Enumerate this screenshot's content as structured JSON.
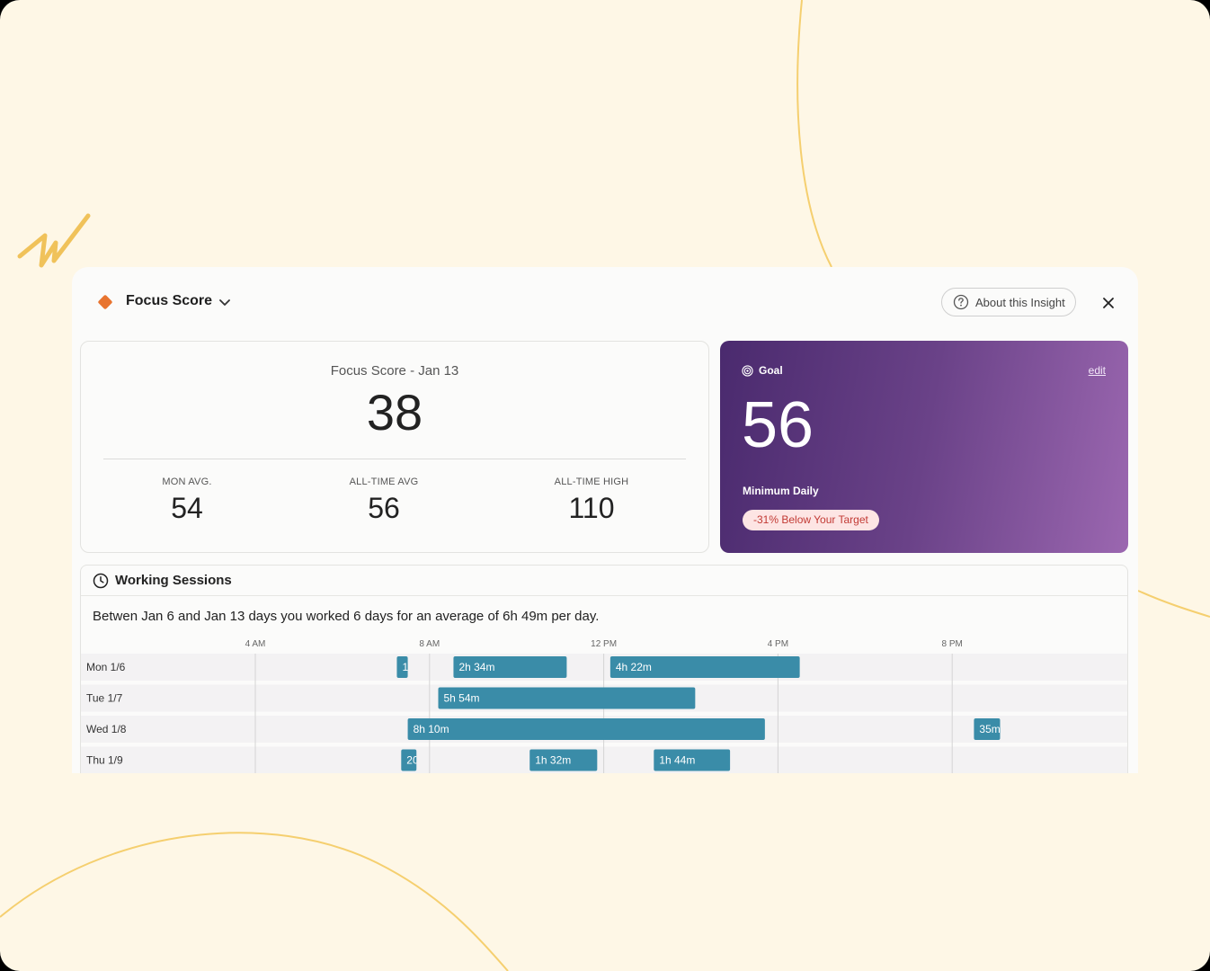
{
  "header": {
    "title": "Focus Score",
    "about_label": "About this Insight"
  },
  "score": {
    "label": "Focus Score - Jan 13",
    "value": "38",
    "stats": [
      {
        "label": "MON AVG.",
        "value": "54"
      },
      {
        "label": "ALL-TIME AVG",
        "value": "56"
      },
      {
        "label": "ALL-TIME HIGH",
        "value": "110"
      }
    ]
  },
  "goal": {
    "label": "Goal",
    "edit_label": "edit",
    "value": "56",
    "subtitle": "Minimum Daily",
    "badge": "-31% Below Your Target"
  },
  "sessions": {
    "title": "Working Sessions",
    "summary": "Betwen Jan 6 and Jan 13 days you worked 6 days for an average of 6h 49m per day."
  },
  "colors": {
    "accent": "#e8742f",
    "bar": "#3a8ca8",
    "goal_start": "#4a2a6e",
    "goal_end": "#9b67b0",
    "badge_text": "#c23a34"
  },
  "chart_data": {
    "type": "gantt",
    "axis_ticks": [
      {
        "label": "4 AM",
        "hour": 4
      },
      {
        "label": "8 AM",
        "hour": 8
      },
      {
        "label": "12 PM",
        "hour": 12
      },
      {
        "label": "4 PM",
        "hour": 16
      },
      {
        "label": "8 PM",
        "hour": 20
      }
    ],
    "rows": [
      {
        "label": "Mon 1/6",
        "sessions": [
          {
            "start": 7.25,
            "end": 7.5,
            "label": "1"
          },
          {
            "start": 8.55,
            "end": 11.15,
            "label": "2h 34m"
          },
          {
            "start": 12.15,
            "end": 16.5,
            "label": "4h 22m"
          }
        ]
      },
      {
        "label": "Tue 1/7",
        "sessions": [
          {
            "start": 8.2,
            "end": 14.1,
            "label": "5h 54m"
          }
        ]
      },
      {
        "label": "Wed 1/8",
        "sessions": [
          {
            "start": 7.5,
            "end": 15.7,
            "label": "8h 10m"
          },
          {
            "start": 20.5,
            "end": 21.1,
            "label": "35m"
          }
        ]
      },
      {
        "label": "Thu 1/9",
        "sessions": [
          {
            "start": 7.35,
            "end": 7.7,
            "label": "20"
          },
          {
            "start": 10.3,
            "end": 11.85,
            "label": "1h 32m"
          },
          {
            "start": 13.15,
            "end": 14.9,
            "label": "1h 44m"
          }
        ]
      }
    ]
  }
}
